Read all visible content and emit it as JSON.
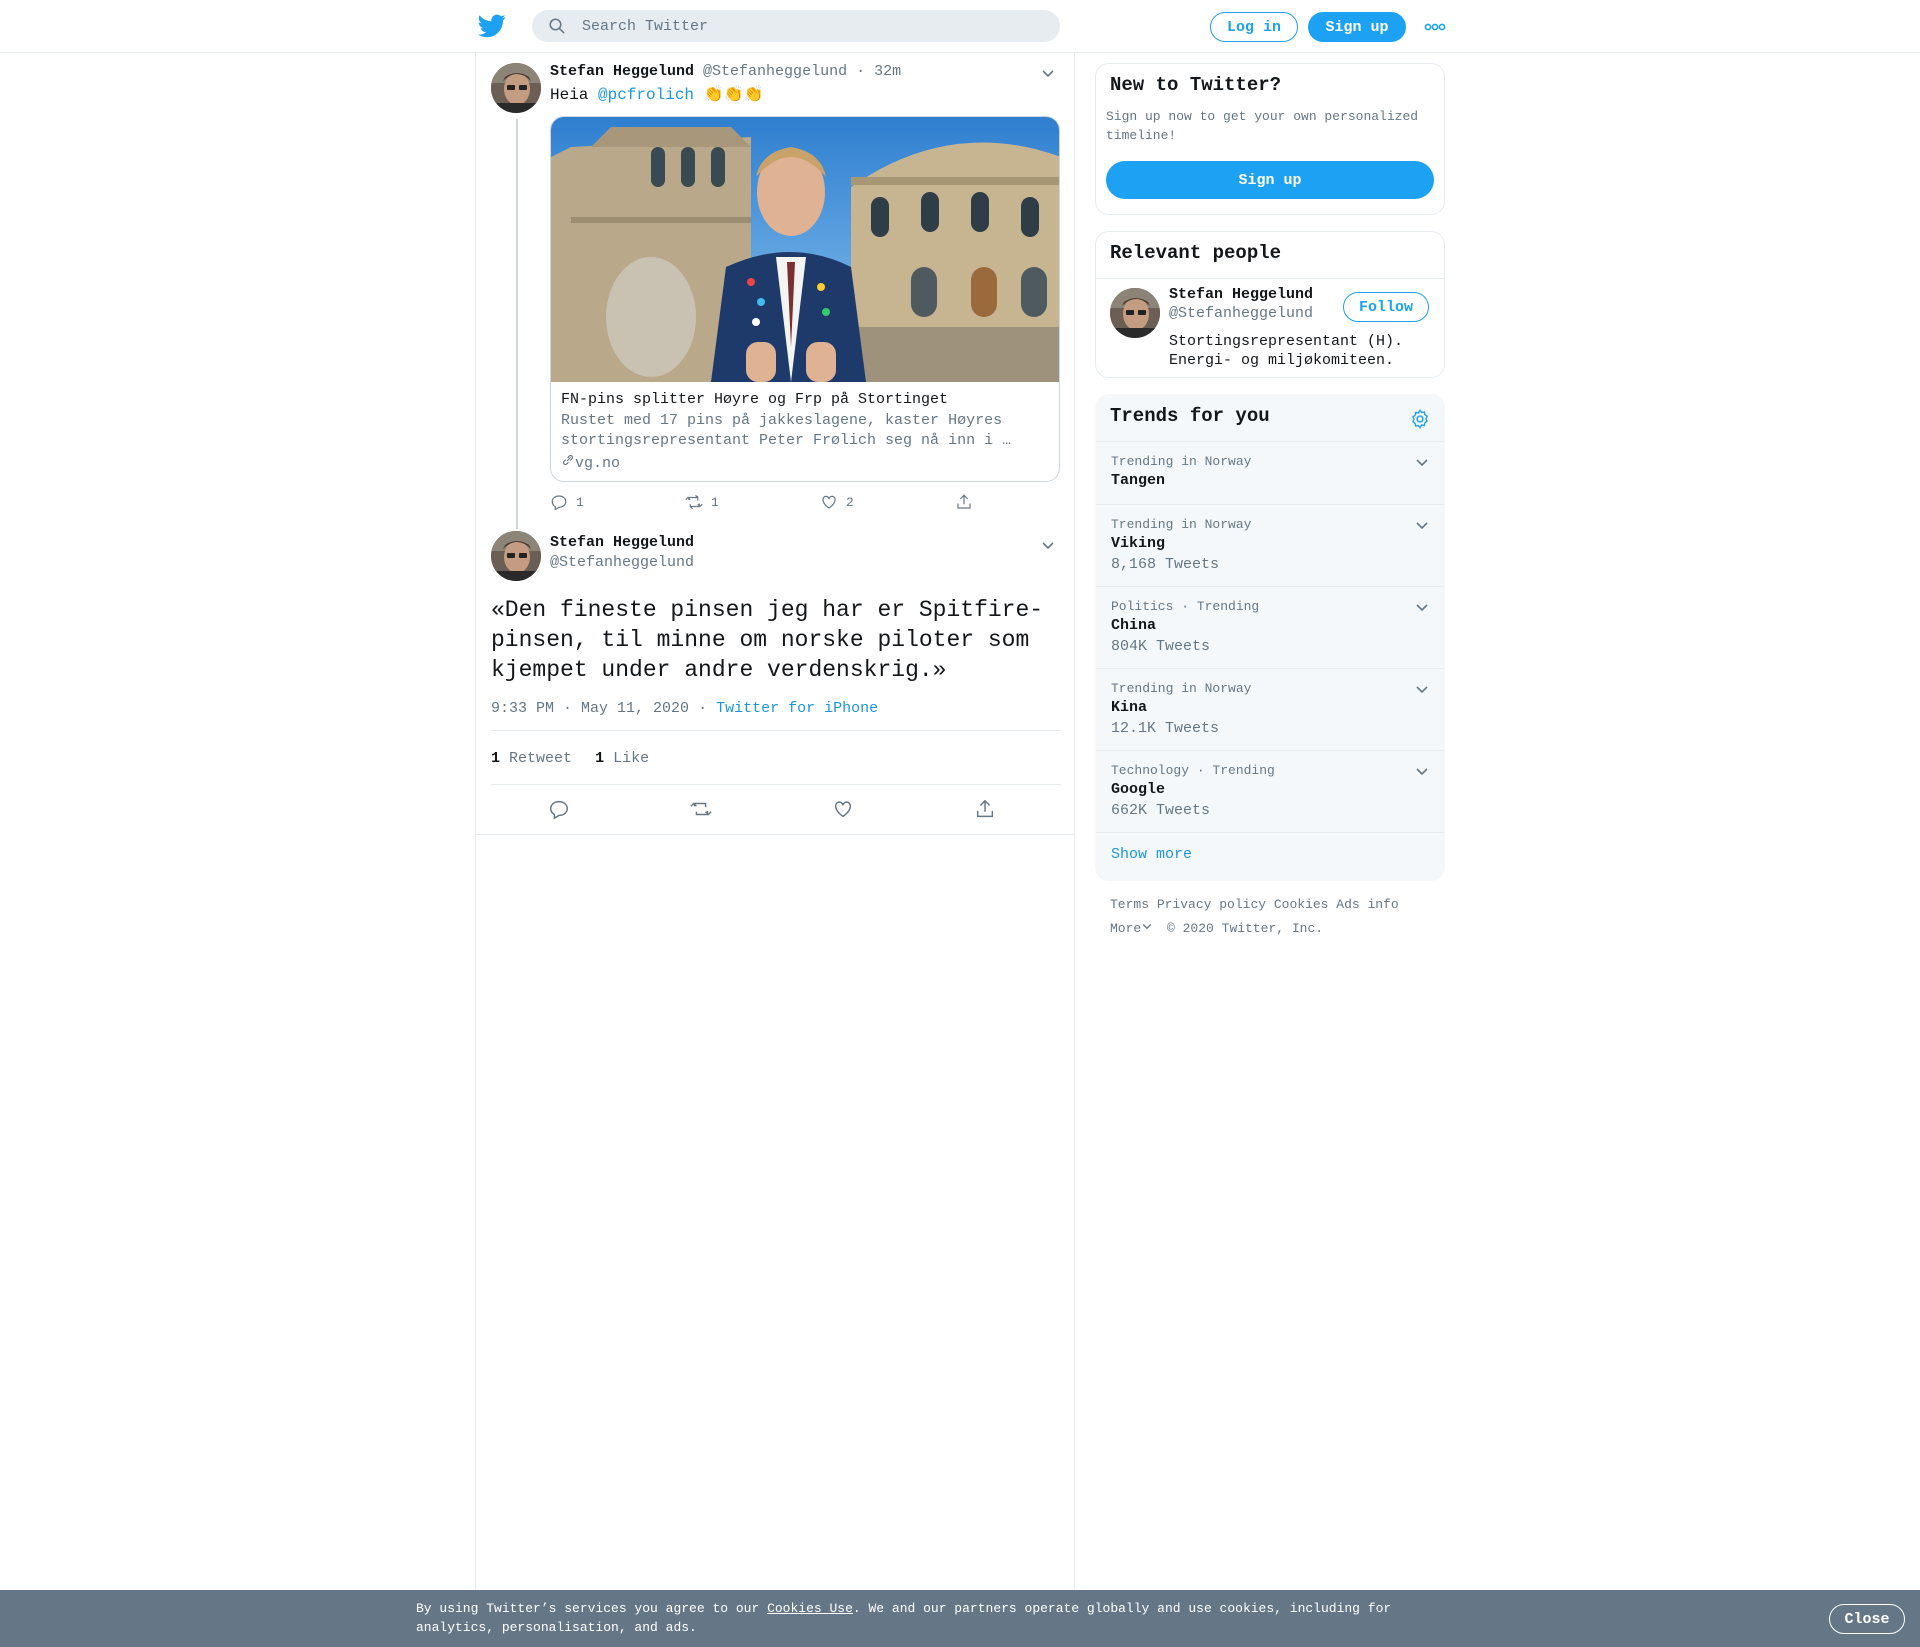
{
  "header": {
    "search_placeholder": "Search Twitter",
    "login_label": "Log in",
    "signup_label": "Sign up",
    "icons": [
      "twitter-bird-icon",
      "search-icon",
      "more-dots-icon"
    ]
  },
  "tweet1": {
    "name": "Stefan Heggelund",
    "handle": "@Stefanheggelund",
    "separator": "·",
    "time": "32m",
    "text_prefix": "Heia ",
    "mention": "@pcfrolich",
    "emoji": "👏👏👏",
    "card": {
      "title": "FN-pins splitter Høyre og Frp på Stortinget",
      "description": "Rustet med 17 pins på jakkeslagene, kaster Høyres stortingsrepresentant Peter Frølich seg nå inn i …",
      "domain": "vg.no"
    },
    "actions": {
      "replies": "1",
      "retweets": "1",
      "likes": "2"
    }
  },
  "tweet2": {
    "name": "Stefan Heggelund",
    "handle": "@Stefanheggelund",
    "text": "«Den fineste pinsen jeg har er Spitfire-pinsen, til minne om norske piloter som kjempet under andre verdenskrig.»",
    "timestamp": "9:33 PM · May 11, 2020",
    "dot": "·",
    "source": "Twitter for iPhone",
    "retweet_count": "1",
    "retweet_label": "Retweet",
    "like_count": "1",
    "like_label": "Like"
  },
  "sidebar": {
    "new_to_twitter": {
      "title": "New to Twitter?",
      "text": "Sign up now to get your own personalized timeline!",
      "button": "Sign up"
    },
    "relevant_people": {
      "title": "Relevant people",
      "name": "Stefan Heggelund",
      "handle": "@Stefanheggelund",
      "bio": "Stortingsrepresentant (H). Energi- og miljøkomiteen.",
      "follow": "Follow"
    },
    "trends": {
      "title": "Trends for you",
      "items": [
        {
          "context": "Trending in Norway",
          "name": "Tangen",
          "count": ""
        },
        {
          "context": "Trending in Norway",
          "name": "Viking",
          "count": "8,168 Tweets"
        },
        {
          "context": "Politics · Trending",
          "name": "China",
          "count": "804K Tweets"
        },
        {
          "context": "Trending in Norway",
          "name": "Kina",
          "count": "12.1K Tweets"
        },
        {
          "context": "Technology · Trending",
          "name": "Google",
          "count": "662K Tweets"
        }
      ],
      "show_more": "Show more"
    },
    "footer": {
      "links": [
        "Terms",
        "Privacy policy",
        "Cookies",
        "Ads info"
      ],
      "more": "More",
      "copyright": "© 2020 Twitter, Inc."
    }
  },
  "cookie_bar": {
    "text_before": "By using Twitter’s services you agree to our ",
    "link": "Cookies Use",
    "text_after": ". We and our partners operate globally and use cookies, including for analytics, personalisation, and ads.",
    "close": "Close"
  },
  "colors": {
    "brand": "#1da1f2",
    "link": "#1b95e0",
    "muted": "#657786",
    "cookie_bg": "#657786"
  }
}
